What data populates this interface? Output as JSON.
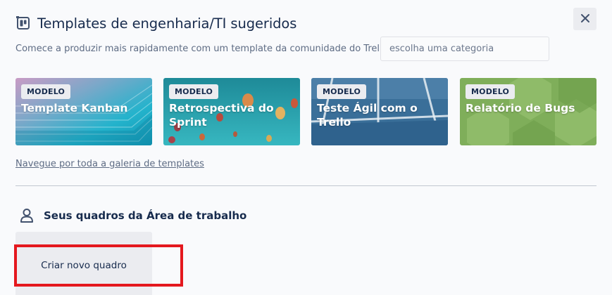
{
  "header": {
    "title": "Templates de engenharia/TI sugeridos",
    "subtitle": "Comece a produzir mais rapidamente com um template da comunidade do Trello ou",
    "category_placeholder": "escolha uma categoria"
  },
  "templates": [
    {
      "badge": "MODELO",
      "name": "Template Kanban"
    },
    {
      "badge": "MODELO",
      "name": "Retrospectiva do Sprint"
    },
    {
      "badge": "MODELO",
      "name": "Teste Ágil com o Trello"
    },
    {
      "badge": "MODELO",
      "name": "Relatório de Bugs"
    }
  ],
  "gallery_link": "Navegue por toda a galeria de templates",
  "workspace": {
    "heading": "Seus quadros da Área de trabalho",
    "create_board_label": "Criar novo quadro"
  },
  "icons": {
    "title": "template-board-icon",
    "close": "close-icon",
    "workspace": "person-icon"
  },
  "colors": {
    "highlight": "#e4181e",
    "text": "#172b4d",
    "muted": "#5e6c84"
  }
}
